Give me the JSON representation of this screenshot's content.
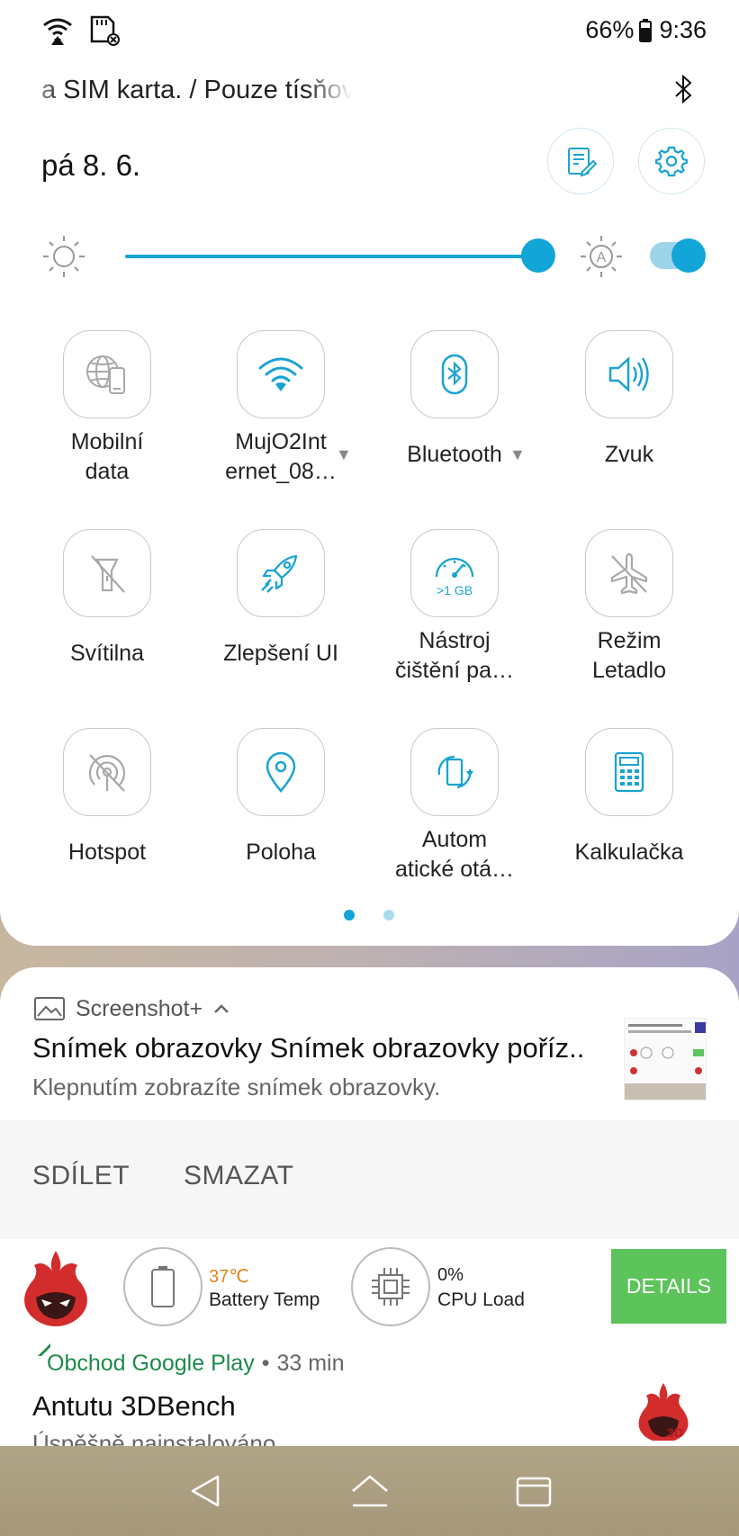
{
  "status_bar": {
    "battery": "66%",
    "time": "9:36"
  },
  "carrier_text": "a SIM karta. / Pouze tísňová volání",
  "date": "pá 8. 6.",
  "quick_tiles": [
    {
      "label": "Mobilní data",
      "icon": "mobile-data-icon",
      "active": false
    },
    {
      "label": "MujO2Internet_08…",
      "icon": "wifi-icon",
      "active": true,
      "expandable": true
    },
    {
      "label": "Bluetooth",
      "icon": "bluetooth-icon",
      "active": true,
      "expandable": true
    },
    {
      "label": "Zvuk",
      "icon": "sound-icon",
      "active": true
    },
    {
      "label": "Svítilna",
      "icon": "flashlight-icon",
      "active": false
    },
    {
      "label": "Zlepšení UI",
      "icon": "rocket-icon",
      "active": true
    },
    {
      "label": "Nástroj čištění pa…",
      "icon": "cleaner-icon",
      "active": true,
      "icon_text": ">1 GB"
    },
    {
      "label": "Režim Letadlo",
      "icon": "airplane-icon",
      "active": false
    },
    {
      "label": "Hotspot",
      "icon": "hotspot-icon",
      "active": false
    },
    {
      "label": "Poloha",
      "icon": "location-icon",
      "active": true
    },
    {
      "label": "Automatické otá…",
      "icon": "auto-rotate-icon",
      "active": true
    },
    {
      "label": "Kalkulačka",
      "icon": "calculator-icon",
      "active": true
    }
  ],
  "tile_labels": {
    "t0a": "Mobilní",
    "t0b": "data",
    "t1a": "MujO2Int",
    "t1b": "ernet_08…",
    "t2": "Bluetooth",
    "t3": "Zvuk",
    "t4": "Svítilna",
    "t5": "Zlepšení UI",
    "t6a": "Nástroj",
    "t6b": "čištění pa…",
    "t7a": "Režim",
    "t7b": "Letadlo",
    "t8": "Hotspot",
    "t9": "Poloha",
    "t10a": "Autom",
    "t10b": "atické otá…",
    "t11": "Kalkulačka",
    "cleaner_badge": ">1 GB"
  },
  "brightness_level": 0.95,
  "auto_brightness": true,
  "page_indicator": {
    "current": 1,
    "total": 2
  },
  "screenshot_notification": {
    "app": "Screenshot+",
    "title": "Snímek obrazovky Snímek obrazovky poříz..",
    "text": "Klepnutím zobrazíte snímek obrazovky.",
    "actions": [
      "SDÍLET",
      "SMAZAT"
    ]
  },
  "antutu_widget": {
    "battery_temp_value": "37℃",
    "battery_temp_label": "Battery Temp",
    "cpu_load_value": "0%",
    "cpu_load_label": "CPU Load",
    "details_label": "DETAILS"
  },
  "play_notification": {
    "app": "Obchod Google Play",
    "separator": "•",
    "time": "33 min",
    "title": "Antutu 3DBench",
    "text": "Úspěšně nainstalováno"
  },
  "colors": {
    "accent": "#12a5d8",
    "active_icon": "#1aa3d1",
    "inactive_icon": "#a8a8a8",
    "details_green": "#5cc45a",
    "temp_orange": "#e0841a",
    "play_green": "#1e8a4a"
  }
}
